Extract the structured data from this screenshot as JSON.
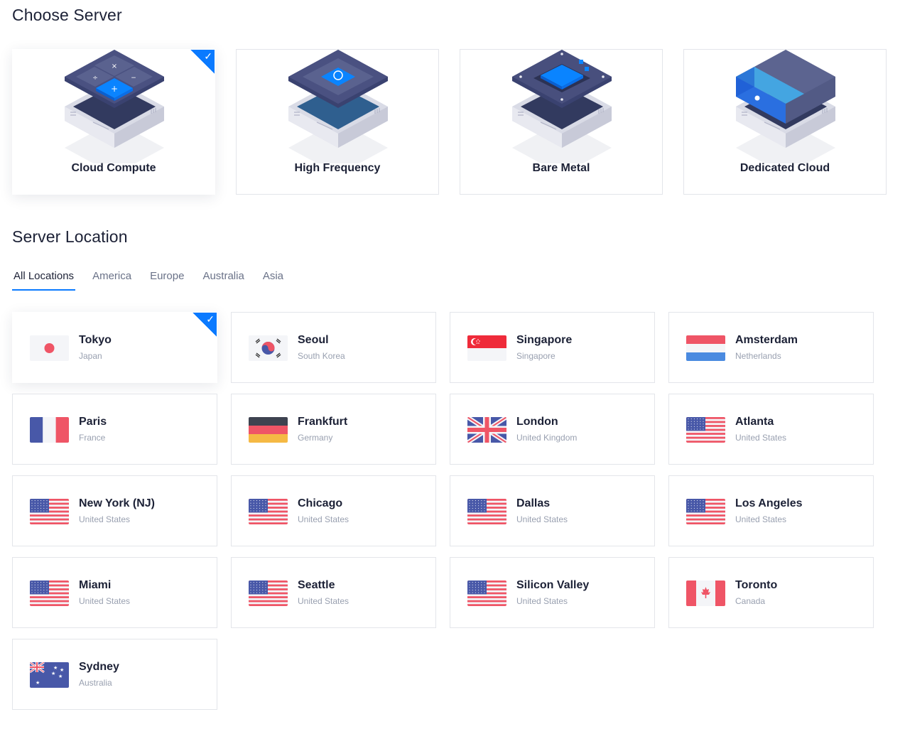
{
  "choose_server": {
    "title": "Choose Server",
    "selected_index": 0,
    "options": [
      {
        "label": "Cloud Compute",
        "icon": "calculator-server-icon",
        "selected": true
      },
      {
        "label": "High Frequency",
        "icon": "speedometer-server-icon",
        "selected": false
      },
      {
        "label": "Bare Metal",
        "icon": "chip-server-icon",
        "selected": false
      },
      {
        "label": "Dedicated Cloud",
        "icon": "cloud-block-server-icon",
        "selected": false
      }
    ]
  },
  "server_location": {
    "title": "Server Location",
    "tabs": [
      {
        "label": "All Locations",
        "active": true
      },
      {
        "label": "America",
        "active": false
      },
      {
        "label": "Europe",
        "active": false
      },
      {
        "label": "Australia",
        "active": false
      },
      {
        "label": "Asia",
        "active": false
      }
    ],
    "locations": [
      {
        "city": "Tokyo",
        "country": "Japan",
        "flag": "jp",
        "selected": true
      },
      {
        "city": "Seoul",
        "country": "South Korea",
        "flag": "kr",
        "selected": false
      },
      {
        "city": "Singapore",
        "country": "Singapore",
        "flag": "sg",
        "selected": false
      },
      {
        "city": "Amsterdam",
        "country": "Netherlands",
        "flag": "nl",
        "selected": false
      },
      {
        "city": "Paris",
        "country": "France",
        "flag": "fr",
        "selected": false
      },
      {
        "city": "Frankfurt",
        "country": "Germany",
        "flag": "de",
        "selected": false
      },
      {
        "city": "London",
        "country": "United Kingdom",
        "flag": "gb",
        "selected": false
      },
      {
        "city": "Atlanta",
        "country": "United States",
        "flag": "us",
        "selected": false
      },
      {
        "city": "New York (NJ)",
        "country": "United States",
        "flag": "us",
        "selected": false
      },
      {
        "city": "Chicago",
        "country": "United States",
        "flag": "us",
        "selected": false
      },
      {
        "city": "Dallas",
        "country": "United States",
        "flag": "us",
        "selected": false
      },
      {
        "city": "Los Angeles",
        "country": "United States",
        "flag": "us",
        "selected": false
      },
      {
        "city": "Miami",
        "country": "United States",
        "flag": "us",
        "selected": false
      },
      {
        "city": "Seattle",
        "country": "United States",
        "flag": "us",
        "selected": false
      },
      {
        "city": "Silicon Valley",
        "country": "United States",
        "flag": "us",
        "selected": false
      },
      {
        "city": "Toronto",
        "country": "Canada",
        "flag": "ca",
        "selected": false
      },
      {
        "city": "Sydney",
        "country": "Australia",
        "flag": "au",
        "selected": false
      }
    ]
  },
  "colors": {
    "accent": "#0a7aff",
    "text_primary": "#1c2136",
    "text_secondary": "#99a0b0",
    "tab_inactive": "#6a7288",
    "card_border": "#e3e5ea",
    "flag_red": "#ef5566",
    "flag_blue": "#4858a8"
  },
  "selection_check_icon": "checkmark-icon"
}
